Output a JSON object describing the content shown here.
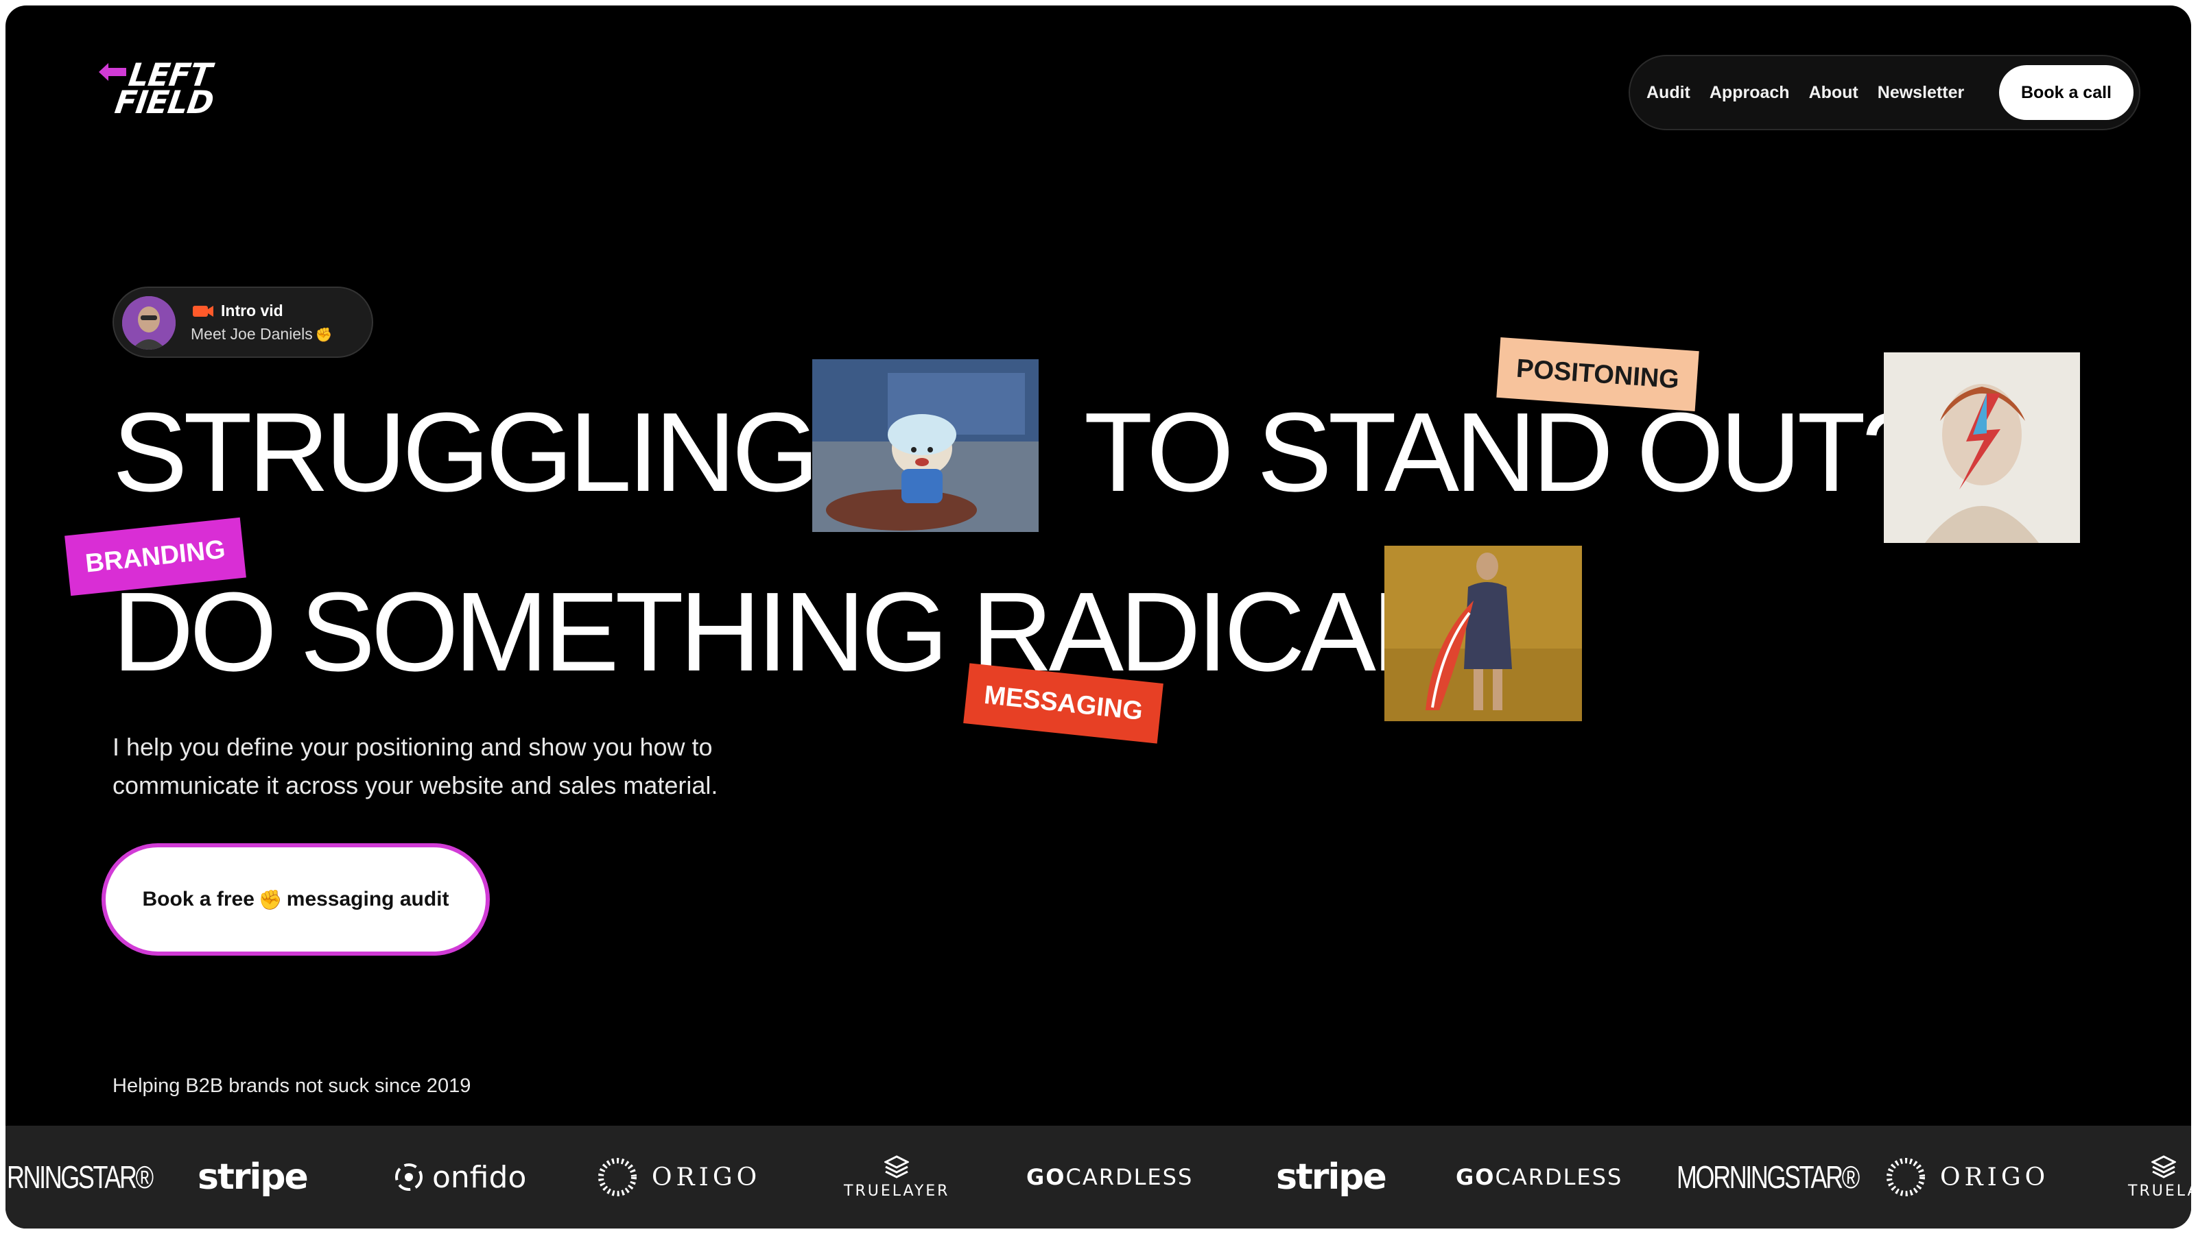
{
  "header": {
    "logo": {
      "line1": "LEFT",
      "line2": "FIELD",
      "arrow_color": "#d13bd6"
    },
    "nav": [
      {
        "label": "Audit"
      },
      {
        "label": "Approach"
      },
      {
        "label": "About"
      },
      {
        "label": "Newsletter"
      }
    ],
    "cta": "Book a call"
  },
  "intro": {
    "icon": "video-camera-icon",
    "title": "Intro vid",
    "subtitle": "Meet Joe Daniels",
    "emoji": "✊"
  },
  "hero": {
    "line1_left": "STRUGGLING",
    "line1_right": "TO STAND OUT?",
    "line2": "DO SOMETHING RADICAL",
    "tags": {
      "positioning": "POSITONING",
      "branding": "BRANDING",
      "messaging": "MESSAGING"
    },
    "tag_colors": {
      "positioning": "#f7c39c",
      "branding": "#d92ed5",
      "messaging": "#e74025"
    },
    "lede": "I help you define your positioning and show you how to communicate it across your website and sales material.",
    "cta": {
      "before": "Book a free",
      "emoji": "✊",
      "after": "messaging audit"
    },
    "cta_border_color": "#d13bd6"
  },
  "since": "Helping B2B brands not suck since 2019",
  "logos": [
    {
      "name": "morningstar-partial",
      "text": "RNINGSTAR®"
    },
    {
      "name": "stripe",
      "text": "stripe"
    },
    {
      "name": "onfido",
      "text": "onfido"
    },
    {
      "name": "origo",
      "text": "ORIGO"
    },
    {
      "name": "truelayer",
      "text": "TRUELAYER"
    },
    {
      "name": "gocardless",
      "bold": "GO",
      "rest": "CARDLESS"
    },
    {
      "name": "stripe-2",
      "text": "stripe"
    },
    {
      "name": "gocardless-2",
      "bold": "GO",
      "rest": "CARDLESS"
    },
    {
      "name": "morningstar",
      "text": "MORNINGSTAR®"
    },
    {
      "name": "origo-2",
      "text": "ORIGO"
    },
    {
      "name": "truelayer-partial",
      "text": "TRUELA"
    }
  ]
}
